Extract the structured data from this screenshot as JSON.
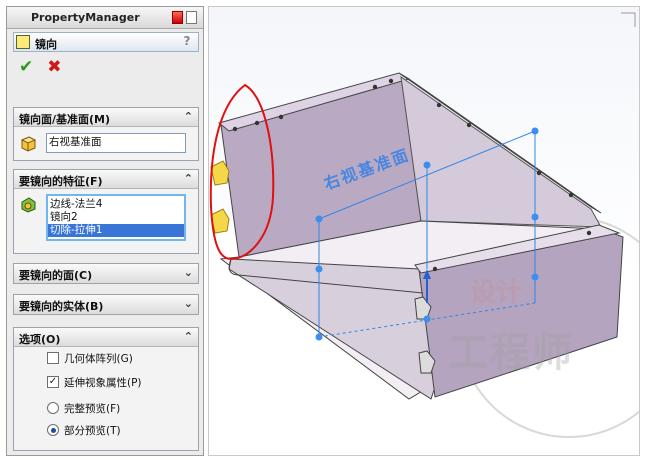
{
  "panel": {
    "title": "PropertyManager",
    "feature_name": "镜向",
    "help": "?",
    "ok": "✔",
    "cancel": "✖"
  },
  "mirror_face": {
    "title": "镜向面/基准面(M)",
    "value": "右视基准面"
  },
  "features": {
    "title": "要镜向的特征(F)",
    "items": [
      "边线-法兰4",
      "镜向2",
      "切除-拉伸1"
    ],
    "selected_index": 2
  },
  "faces": {
    "title": "要镜向的面(C)"
  },
  "bodies": {
    "title": "要镜向的实体(B)"
  },
  "options": {
    "title": "选项(O)",
    "geometry_pattern": {
      "label": "几何体阵列(G)",
      "checked": false
    },
    "propagate_visual": {
      "label": "延伸视象属性(P)",
      "checked": true
    },
    "full_preview": {
      "label": "完整预览(F)",
      "selected": false
    },
    "partial_preview": {
      "label": "部分预览(T)",
      "selected": true
    }
  },
  "viewport": {
    "plane_label": "右视基准面",
    "watermark_top": "设计",
    "watermark_bottom": "工程师"
  },
  "colors": {
    "accent": "#3875d7",
    "plane_blue": "#2e86e8",
    "annotation_red": "#e01010",
    "part_fill": "#b9a9c3"
  }
}
